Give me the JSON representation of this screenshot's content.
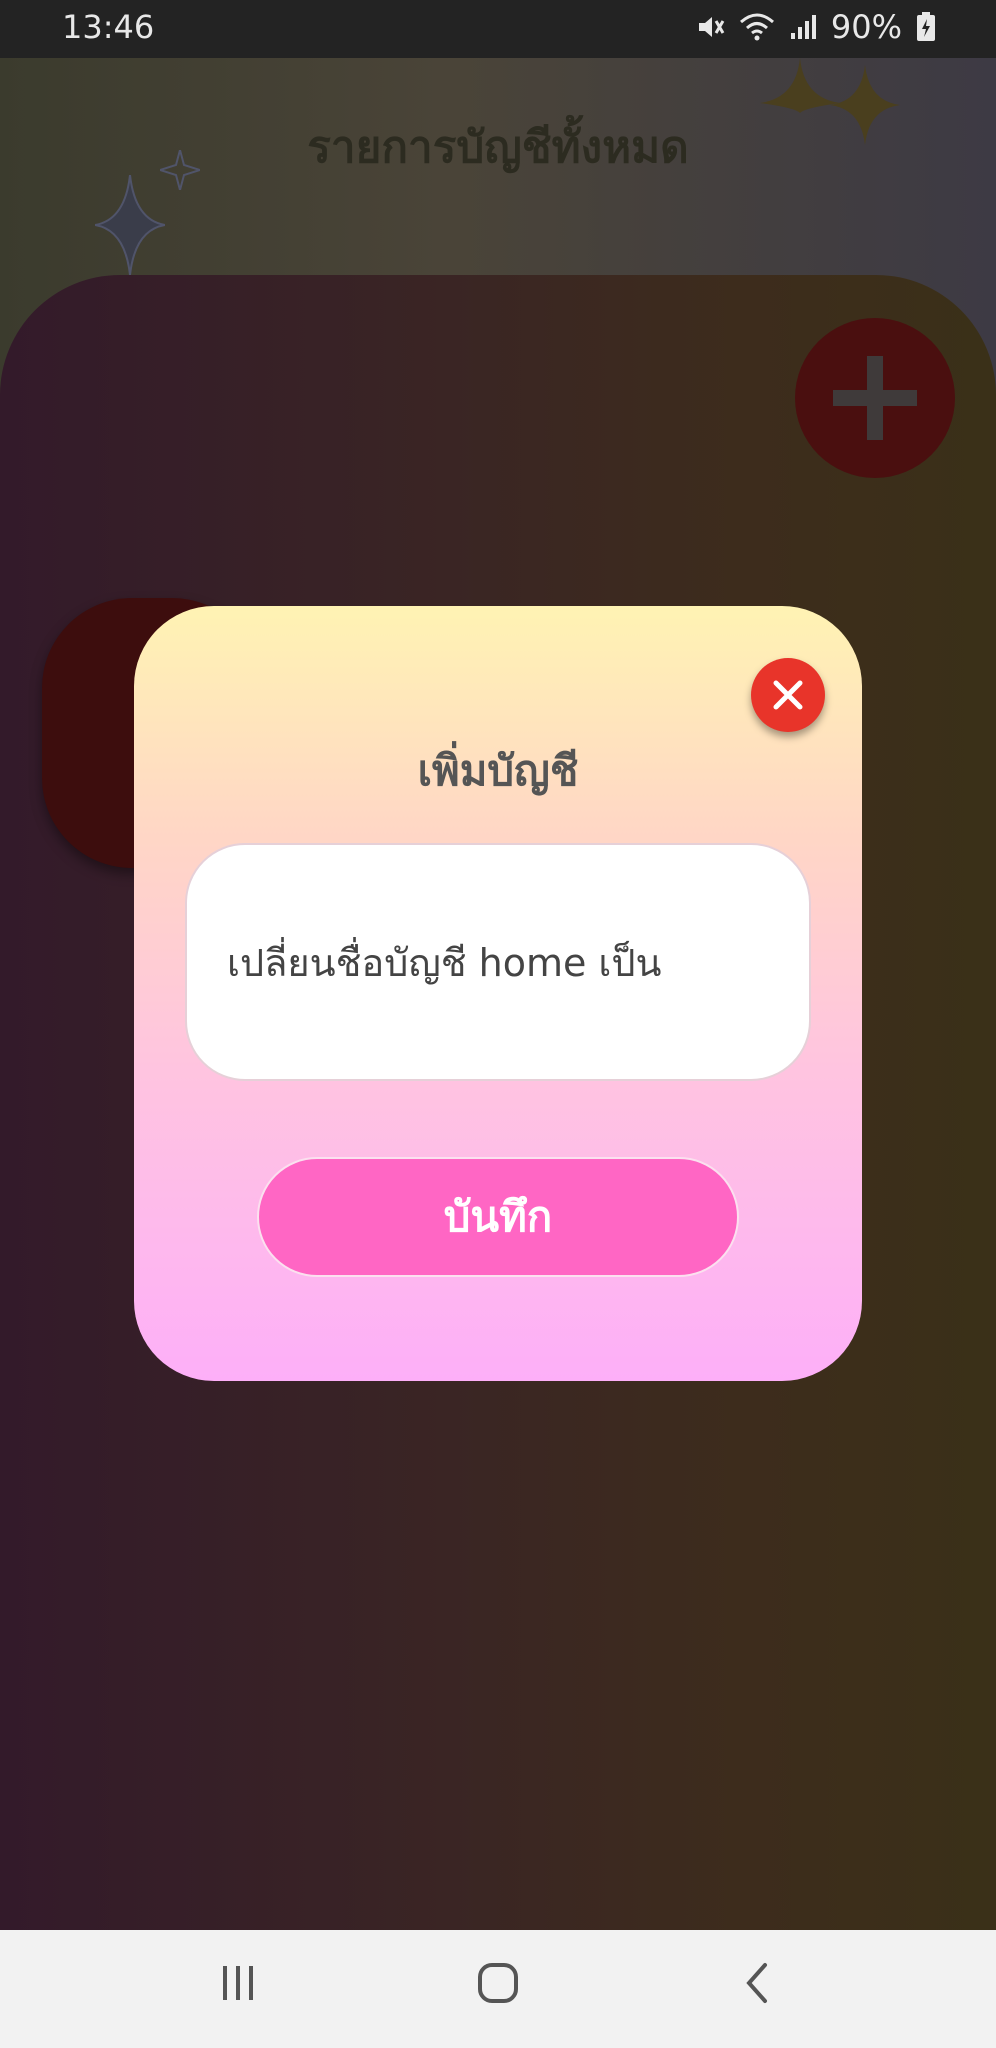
{
  "status_bar": {
    "time": "13:46",
    "battery": "90%",
    "icons": [
      "mute-icon",
      "wifi-icon",
      "signal-icon",
      "battery-charging-icon"
    ]
  },
  "screen": {
    "title": "รายการบัญชีทั้งหมด",
    "add_button_icon": "plus-icon"
  },
  "dialog": {
    "title": "เพิ่มบัญชี",
    "input_value": "เปลี่ยนชื่อบัญชี home เป็น",
    "save_label": "บันทึก",
    "close_icon": "close-icon"
  },
  "nav_bar": {
    "buttons": [
      "recent-apps-icon",
      "home-icon",
      "back-icon"
    ]
  },
  "colors": {
    "dialog_gradient_top": "#fff3b3",
    "dialog_gradient_bottom": "#fdaff8",
    "save_button": "#ff66c4",
    "close_button": "#e8342a"
  }
}
